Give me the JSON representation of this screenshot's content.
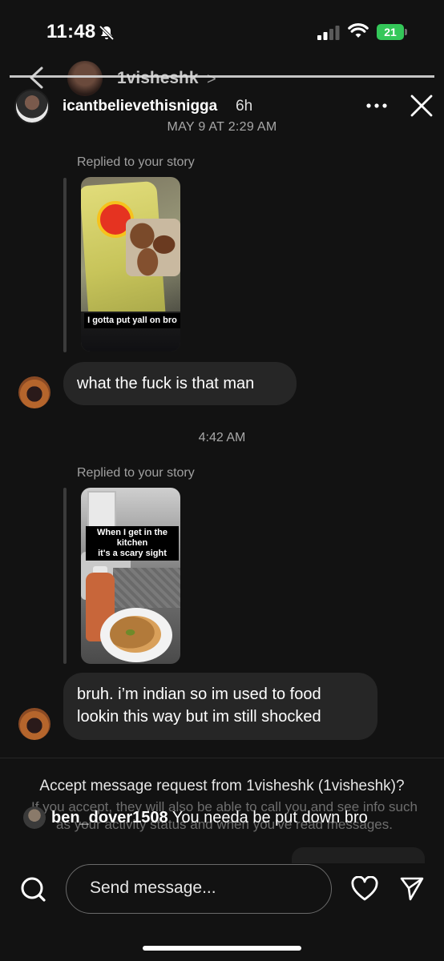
{
  "status_bar": {
    "time": "11:48",
    "battery": "21"
  },
  "thread_header": {
    "username": "1visheshk",
    "chevron": ">"
  },
  "story_header": {
    "username": "icantbelievethisnigga",
    "posted_ago": "6h",
    "date": "MAY 9 AT 2:29 AM"
  },
  "messages": [
    {
      "reply_label": "Replied to your story",
      "story_caption": "I gotta put yall on bro",
      "text": "what the fuck is that man"
    },
    {
      "reply_label": "Replied to your story",
      "story_caption_line1": "When I get in the kitchen",
      "story_caption_line2": "it's a scary sight",
      "text_line1": "bruh. i’m indian so im used to food",
      "text_line2": "lookin this way but im still shocked"
    }
  ],
  "time_separator": "4:42 AM",
  "request": {
    "title": "Accept message request from 1visheshk (1visheshk)?",
    "info": "If you accept, they will also be able to call you and see info such as your activity status and when you've read messages."
  },
  "overlay_comment": {
    "username": "ben_dover1508",
    "text": "You needa be put down bro"
  },
  "composer": {
    "placeholder": "Send message..."
  },
  "colors": {
    "battery": "#34c759",
    "bubble": "#262626",
    "background": "#121212"
  },
  "icons": [
    "bell-slash-icon",
    "signal-icon",
    "wifi-icon",
    "back-arrow-icon",
    "more-icon",
    "close-icon",
    "search-icon",
    "heart-icon",
    "send-icon"
  ]
}
